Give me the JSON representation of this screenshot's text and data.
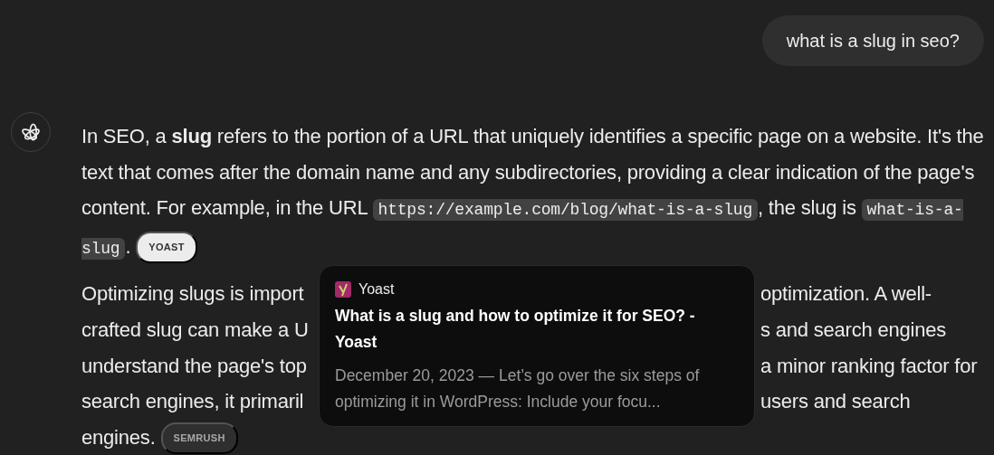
{
  "user_message": {
    "text": "what is a slug in seo?"
  },
  "response": {
    "paragraphs": [
      {
        "kind": "full",
        "segments": [
          {
            "kind": "text",
            "text": "In SEO, a **slug** refers to the portion of a URL that uniquely identifies a specific page on a website. It's the text that comes after the domain name and any subdirectories, providing a clear indication of the page's content. For example, in the URL "
          },
          {
            "kind": "code",
            "text": "https://example.com/blog/what-is-a-slug"
          },
          {
            "kind": "text",
            "text": ", the slug is "
          },
          {
            "kind": "code",
            "text": "what-is-a-slug"
          },
          {
            "kind": "text",
            "text": "."
          }
        ],
        "citation": {
          "label": "YOAST",
          "active": true
        }
      },
      {
        "kind": "covered",
        "lines": [
          {
            "left": "Optimizing slugs is import",
            "right": "optimization. A well-"
          },
          {
            "left": "crafted slug can make a U",
            "right": "s and search engines"
          },
          {
            "left": "understand the page's top",
            "right": "a minor ranking factor for"
          },
          {
            "left": "search engines, it primaril",
            "right": "users and search"
          }
        ],
        "tail": "engines.",
        "citation": {
          "label": "SEMRUSH",
          "active": false
        }
      }
    ]
  },
  "tooltip": {
    "source": "Yoast",
    "title": "What is a slug and how to optimize it for SEO? - Yoast",
    "snippet": "December 20, 2023 — Let’s go over the six steps of optimizing it in WordPress: Include your focu..."
  }
}
